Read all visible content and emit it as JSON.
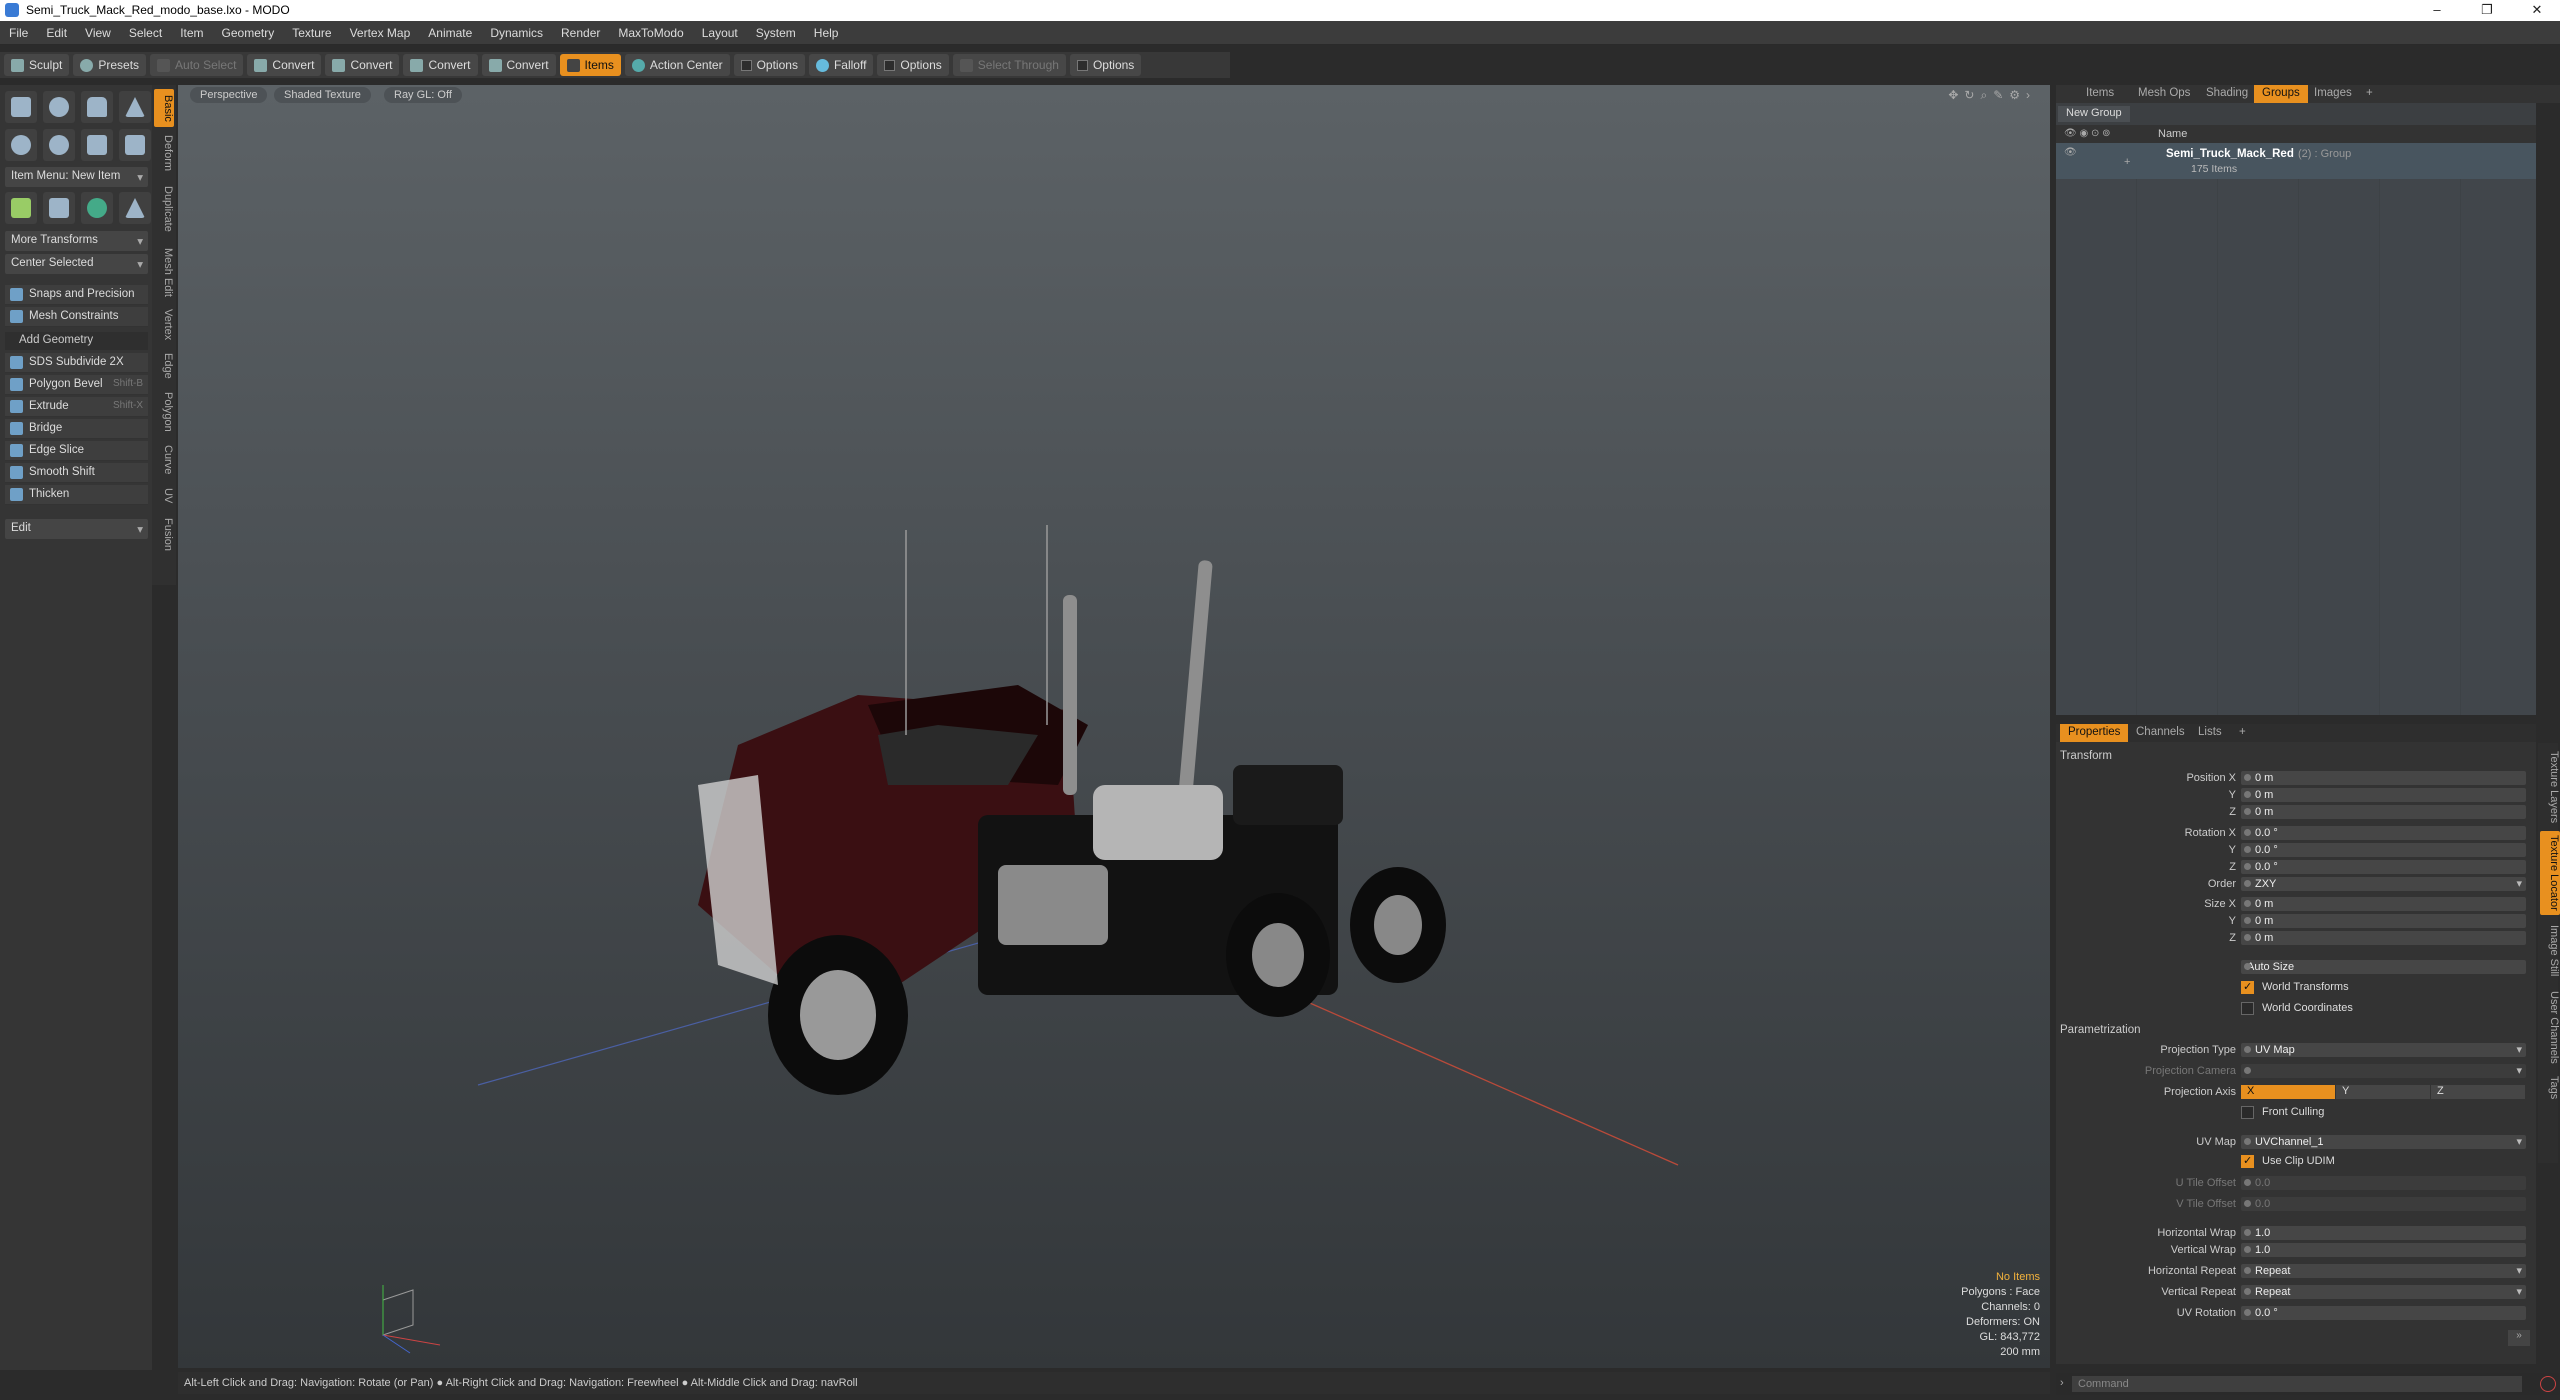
{
  "window": {
    "title": "Semi_Truck_Mack_Red_modo_base.lxo - MODO",
    "min": "–",
    "max": "❐",
    "close": "✕"
  },
  "menu": [
    "File",
    "Edit",
    "View",
    "Select",
    "Item",
    "Geometry",
    "Texture",
    "Vertex Map",
    "Animate",
    "Dynamics",
    "Render",
    "MaxToModo",
    "Layout",
    "System",
    "Help"
  ],
  "toolbar": {
    "sculpt": "Sculpt",
    "presets": "Presets",
    "auto_select": "Auto Select",
    "convert1": "Convert",
    "convert2": "Convert",
    "convert3": "Convert",
    "convert4": "Convert",
    "items": "Items",
    "action_center": "Action Center",
    "options1": "Options",
    "falloff": "Falloff",
    "options2": "Options",
    "select_through": "Select Through",
    "options3": "Options"
  },
  "left": {
    "item_menu": "Item Menu: New Item",
    "more_transforms": "More Transforms",
    "center_selected": "Center Selected",
    "snaps": "Snaps and Precision",
    "mesh_constraints": "Mesh Constraints",
    "add_geometry": "Add Geometry",
    "tools": [
      {
        "label": "SDS Subdivide 2X",
        "shortcut": ""
      },
      {
        "label": "Polygon Bevel",
        "shortcut": "Shift-B"
      },
      {
        "label": "Extrude",
        "shortcut": "Shift-X"
      },
      {
        "label": "Bridge",
        "shortcut": ""
      },
      {
        "label": "Edge Slice",
        "shortcut": ""
      },
      {
        "label": "Smooth Shift",
        "shortcut": ""
      },
      {
        "label": "Thicken",
        "shortcut": ""
      }
    ],
    "edit": "Edit",
    "side_tabs": [
      "Basic",
      "Deform",
      "Duplicate",
      "Mesh Edit",
      "Vertex",
      "Edge",
      "Polygon",
      "Curve",
      "UV",
      "Fusion"
    ]
  },
  "viewport": {
    "view": "Perspective",
    "shading": "Shaded Texture",
    "raygl": "Ray GL: Off",
    "stats": {
      "items": "No Items",
      "polygons": "Polygons : Face",
      "channels": "Channels: 0",
      "deformers": "Deformers: ON",
      "gl": "GL: 843,772",
      "size": "200 mm"
    }
  },
  "status": "Alt-Left Click and Drag: Navigation: Rotate (or Pan) ● Alt-Right Click and Drag: Navigation: Freewheel ● Alt-Middle Click and Drag: navRoll",
  "right_tabs": [
    "Items",
    "Mesh Ops",
    "Shading",
    "Groups",
    "Images",
    "+"
  ],
  "groups": {
    "new_group": "New Group",
    "col_name": "Name",
    "group_name": "Semi_Truck_Mack_Red",
    "group_suffix": "(2) : Group",
    "count": "175 Items"
  },
  "props": {
    "tabs": [
      "Properties",
      "Channels",
      "Lists",
      "+"
    ],
    "transform": "Transform",
    "pos_x_label": "Position X",
    "pos_x": "0 m",
    "y_label": "Y",
    "pos_y": "0 m",
    "z_label": "Z",
    "pos_z": "0 m",
    "rot_x_label": "Rotation X",
    "rot_x": "0.0 °",
    "rot_y": "0.0 °",
    "rot_z": "0.0 °",
    "order_label": "Order",
    "order": "ZXY",
    "size_x_label": "Size X",
    "size_x": "0 m",
    "size_y": "0 m",
    "size_z": "0 m",
    "auto_size": "Auto Size",
    "world_transforms": "World Transforms",
    "world_coords": "World Coordinates",
    "param": "Parametrization",
    "proj_type_label": "Projection Type",
    "proj_type": "UV Map",
    "proj_cam_label": "Projection Camera",
    "proj_axis_label": "Projection Axis",
    "axis_x": "X",
    "axis_y": "Y",
    "axis_z": "Z",
    "front_culling": "Front Culling",
    "uvmap_label": "UV Map",
    "uvmap": "UVChannel_1",
    "use_udim": "Use Clip UDIM",
    "u_off_label": "U Tile Offset",
    "u_off": "0.0",
    "v_off_label": "V Tile Offset",
    "v_off": "0.0",
    "hwrap_label": "Horizontal Wrap",
    "hwrap": "1.0",
    "vwrap_label": "Vertical Wrap",
    "vwrap": "1.0",
    "hrep_label": "Horizontal Repeat",
    "hrep": "Repeat",
    "vrep_label": "Vertical Repeat",
    "vrep": "Repeat",
    "uvrot_label": "UV Rotation",
    "uvrot": "0.0 °"
  },
  "right_vtabs": [
    "Texture Layers",
    "Texture Locator",
    "Image Still",
    "User Channels",
    "Tags"
  ],
  "command_placeholder": "Command"
}
